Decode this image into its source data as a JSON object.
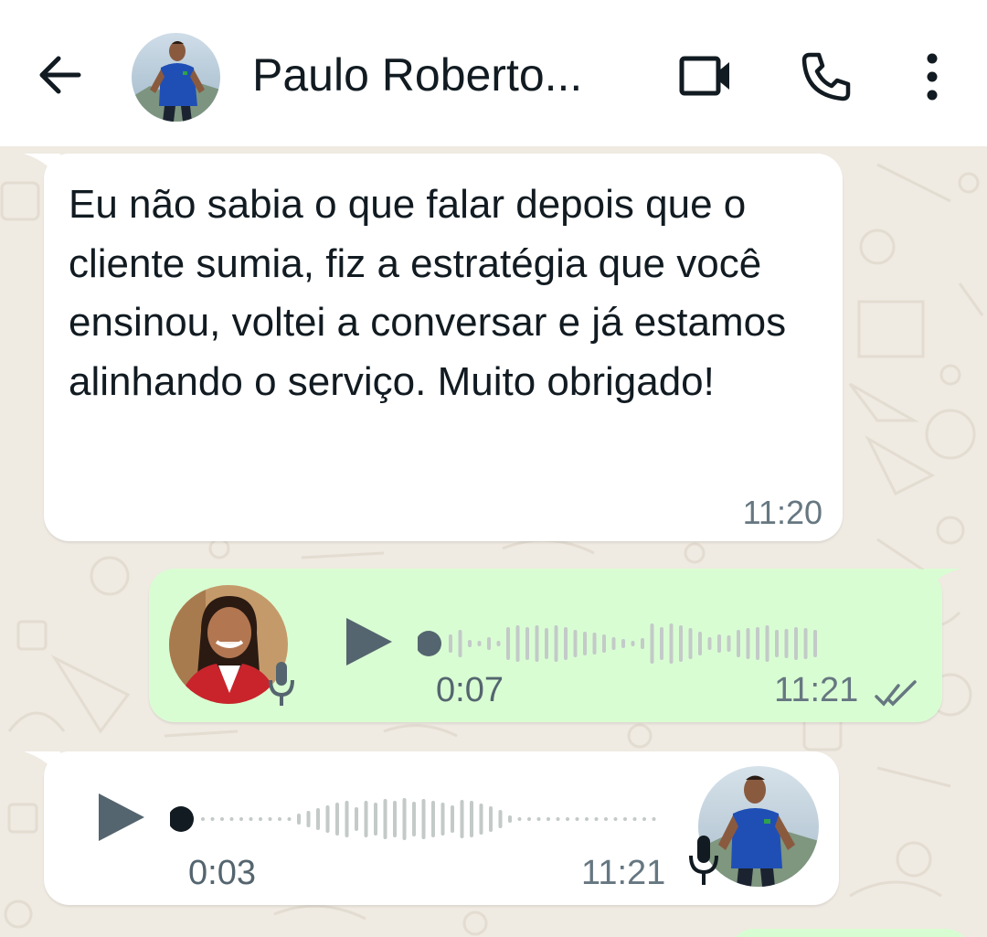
{
  "header": {
    "contact_name": "Paulo Roberto...",
    "icons": [
      "arrow-left-icon",
      "video-camera-icon",
      "phone-icon",
      "more-vertical-icon"
    ]
  },
  "messages": [
    {
      "type": "text",
      "direction": "incoming",
      "text": "Eu não sabia o que falar depois que o cliente sumia, fiz a estratégia que você ensinou, voltei a conversar e já estamos alinhando o serviço. Muito obrigado!",
      "time": "11:20"
    },
    {
      "type": "voice",
      "direction": "outgoing",
      "duration": "0:07",
      "time": "11:21",
      "status": "read",
      "progress": 0
    },
    {
      "type": "voice",
      "direction": "incoming",
      "duration": "0:03",
      "time": "11:21",
      "progress": 0
    }
  ],
  "colors": {
    "chat_background": "#efeae2",
    "outgoing_bubble": "#d9fdd3",
    "incoming_bubble": "#ffffff",
    "icon_dark": "#111b21",
    "secondary_text": "#667781",
    "waveform": "#c3cac8",
    "play_button": "#54656f"
  }
}
